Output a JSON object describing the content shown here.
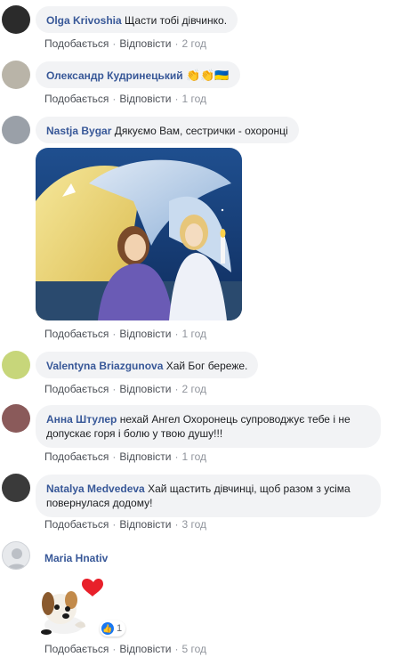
{
  "actions": {
    "like": "Подобається",
    "reply": "Відповісти",
    "sep": "·"
  },
  "comments": [
    {
      "author": "Olga Krivoshia",
      "text": "Щасти тобі дівчинко.",
      "time": "2 год"
    },
    {
      "author": "Олександр Кудринецький",
      "text": "👏👏🇺🇦",
      "time": "1 год"
    },
    {
      "author": "Nastja Bygar",
      "text": "Дякуємо Вам, сестрички - охоронці",
      "time": "1 год"
    },
    {
      "author": "Valentyna Briazgunova",
      "text": "Хай Бог береже.",
      "time": "2 год"
    },
    {
      "author": "Анна Штулер",
      "text": "нехай Ангел Охоронець супроводжує тебе і не допускає горя і болю у твою душу!!!",
      "time": "1 год"
    },
    {
      "author": "Natalya Medvedeva",
      "text": "Хай щастить дівчинці, щоб разом з усіма повернулася додому!",
      "time": "3 год"
    },
    {
      "author": "Maria Hnativ",
      "text": "",
      "time": "5 год",
      "reaction_count": "1"
    }
  ],
  "colors": {
    "link": "#385898",
    "bubble": "#f2f3f5",
    "like_badge": "#1877f2"
  }
}
